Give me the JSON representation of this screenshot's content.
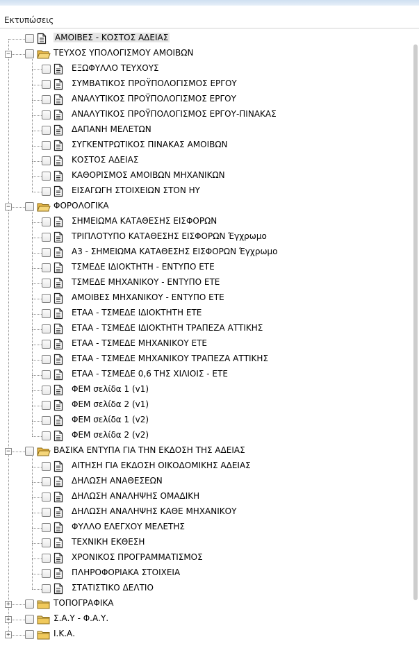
{
  "panel": {
    "title": "Εκτυπώσεις"
  },
  "tree": [
    {
      "label": "ΑΜΟΙΒΕΣ - ΚΟΣΤΟΣ ΑΔΕΙΑΣ",
      "level": 0,
      "type": "doc",
      "selected": true
    },
    {
      "label": "ΤΕΥΧΟΣ ΥΠΟΛΟΓΙΣΜΟΥ ΑΜΟΙΒΩΝ",
      "level": 0,
      "type": "folder",
      "expanded": true
    },
    {
      "label": "ΕΞΩΦΥΛΛΟ ΤΕΥΧΟΥΣ",
      "level": 1,
      "type": "doc"
    },
    {
      "label": "ΣΥΜΒΑΤΙΚΟΣ ΠΡΟΫΠΟΛΟΓΙΣΜΟΣ ΕΡΓΟΥ",
      "level": 1,
      "type": "doc"
    },
    {
      "label": "ΑΝΑΛΥΤΙΚΟΣ ΠΡΟΫΠΟΛΟΓΙΣΜΟΣ ΕΡΓΟΥ",
      "level": 1,
      "type": "doc"
    },
    {
      "label": "ΑΝΑΛΥΤΙΚΟΣ ΠΡΟΫΠΟΛΟΓΙΣΜΟΣ ΕΡΓΟΥ-ΠΙΝΑΚΑΣ",
      "level": 1,
      "type": "doc"
    },
    {
      "label": "ΔΑΠΑΝΗ ΜΕΛΕΤΩΝ",
      "level": 1,
      "type": "doc"
    },
    {
      "label": "ΣΥΓΚΕΝΤΡΩΤΙΚΟΣ ΠΙΝΑΚΑΣ ΑΜΟΙΒΩΝ",
      "level": 1,
      "type": "doc"
    },
    {
      "label": "ΚΟΣΤΟΣ ΑΔΕΙΑΣ",
      "level": 1,
      "type": "doc"
    },
    {
      "label": "ΚΑΘΟΡΙΣΜΟΣ ΑΜΟΙΒΩΝ ΜΗΧΑΝΙΚΩΝ",
      "level": 1,
      "type": "doc"
    },
    {
      "label": "ΕΙΣΑΓΩΓΗ ΣΤΟΙΧΕΙΩΝ ΣΤΟΝ ΗΥ",
      "level": 1,
      "type": "doc"
    },
    {
      "label": "ΦΟΡΟΛΟΓΙΚΑ",
      "level": 0,
      "type": "folder",
      "expanded": true
    },
    {
      "label": "ΣΗΜΕΙΩΜΑ ΚΑΤΑΘΕΣΗΣ ΕΙΣΦΟΡΩΝ",
      "level": 1,
      "type": "doc"
    },
    {
      "label": "ΤΡΙΠΛΟΤΥΠΟ ΚΑΤΑΘΕΣΗΣ ΕΙΣΦΟΡΩΝ Έγχρωμο",
      "level": 1,
      "type": "doc"
    },
    {
      "label": "Α3 - ΣΗΜΕΙΩΜΑ ΚΑΤΑΘΕΣΗΣ ΕΙΣΦΟΡΩΝ Έγχρωμο",
      "level": 1,
      "type": "doc"
    },
    {
      "label": "ΤΣΜΕΔΕ ΙΔΙΟΚΤΗΤΗ - ΕΝΤΥΠΟ ΕΤΕ",
      "level": 1,
      "type": "doc"
    },
    {
      "label": "ΤΣΜΕΔΕ ΜΗΧΑΝΙΚΟΥ - ΕΝΤΥΠΟ ΕΤΕ",
      "level": 1,
      "type": "doc"
    },
    {
      "label": "ΑΜΟΙΒΕΣ ΜΗΧΑΝΙΚΟΥ - ΕΝΤΥΠΟ ΕΤΕ",
      "level": 1,
      "type": "doc"
    },
    {
      "label": "ΕΤΑΑ - ΤΣΜΕΔΕ ΙΔΙΟΚΤΗΤΗ ΕΤΕ",
      "level": 1,
      "type": "doc"
    },
    {
      "label": "ΕΤΑΑ - ΤΣΜΕΔΕ ΙΔΙΟΚΤΗΤΗ ΤΡΑΠΕΖΑ ΑΤΤΙΚΗΣ",
      "level": 1,
      "type": "doc"
    },
    {
      "label": "ΕΤΑΑ - ΤΣΜΕΔΕ ΜΗΧΑΝΙΚΟΥ ΕΤΕ",
      "level": 1,
      "type": "doc"
    },
    {
      "label": "ΕΤΑΑ - ΤΣΜΕΔΕ ΜΗΧΑΝΙΚΟΥ ΤΡΑΠΕΖΑ ΑΤΤΙΚΗΣ",
      "level": 1,
      "type": "doc"
    },
    {
      "label": "ΕΤΑΑ - ΤΣΜΕΔΕ 0,6 ΤΗΣ ΧΙΛΙΟΙΣ - ΕΤΕ",
      "level": 1,
      "type": "doc"
    },
    {
      "label": "ΦΕΜ σελίδα 1 (v1)",
      "level": 1,
      "type": "doc"
    },
    {
      "label": "ΦΕΜ σελίδα 2 (v1)",
      "level": 1,
      "type": "doc"
    },
    {
      "label": "ΦΕΜ σελίδα 1 (v2)",
      "level": 1,
      "type": "doc"
    },
    {
      "label": "ΦΕΜ σελίδα 2 (v2)",
      "level": 1,
      "type": "doc"
    },
    {
      "label": "ΒΑΣΙΚΑ ΕΝΤΥΠΑ ΓΙΑ ΤΗΝ ΕΚΔΟΣΗ ΤΗΣ ΑΔΕΙΑΣ",
      "level": 0,
      "type": "folder",
      "expanded": true
    },
    {
      "label": "ΑΙΤΗΣΗ ΓΙΑ ΕΚΔΟΣΗ ΟΙΚΟΔΟΜΙΚΗΣ ΑΔΕΙΑΣ",
      "level": 1,
      "type": "doc"
    },
    {
      "label": "ΔΗΛΩΣΗ ΑΝΑΘΕΣΕΩΝ",
      "level": 1,
      "type": "doc"
    },
    {
      "label": "ΔΗΛΩΣΗ ΑΝΑΛΗΨΗΣ ΟΜΑΔΙΚΗ",
      "level": 1,
      "type": "doc"
    },
    {
      "label": "ΔΗΛΩΣΗ ΑΝΑΛΗΨΗΣ ΚΑΘΕ ΜΗΧΑΝΙΚΟΥ",
      "level": 1,
      "type": "doc"
    },
    {
      "label": "ΦΥΛΛΟ ΕΛΕΓΧΟΥ ΜΕΛΕΤΗΣ",
      "level": 1,
      "type": "doc"
    },
    {
      "label": "ΤΕΧΝΙΚΗ ΕΚΘΕΣΗ",
      "level": 1,
      "type": "doc"
    },
    {
      "label": "ΧΡΟΝΙΚΟΣ ΠΡΟΓΡΑΜΜΑΤΙΣΜΟΣ",
      "level": 1,
      "type": "doc"
    },
    {
      "label": "ΠΛΗΡΟΦΟΡΙΑΚΑ ΣΤΟΙΧΕΙΑ",
      "level": 1,
      "type": "doc"
    },
    {
      "label": "ΣΤΑΤΙΣΤΙΚΟ ΔΕΛΤΙΟ",
      "level": 1,
      "type": "doc"
    },
    {
      "label": "ΤΟΠΟΓΡΑΦΙΚΑ",
      "level": 0,
      "type": "folder",
      "expanded": false
    },
    {
      "label": "Σ.Α.Υ - Φ.Α.Υ.",
      "level": 0,
      "type": "folder",
      "expanded": false
    },
    {
      "label": "Ι.Κ.Α.",
      "level": 0,
      "type": "folder",
      "expanded": false
    }
  ]
}
